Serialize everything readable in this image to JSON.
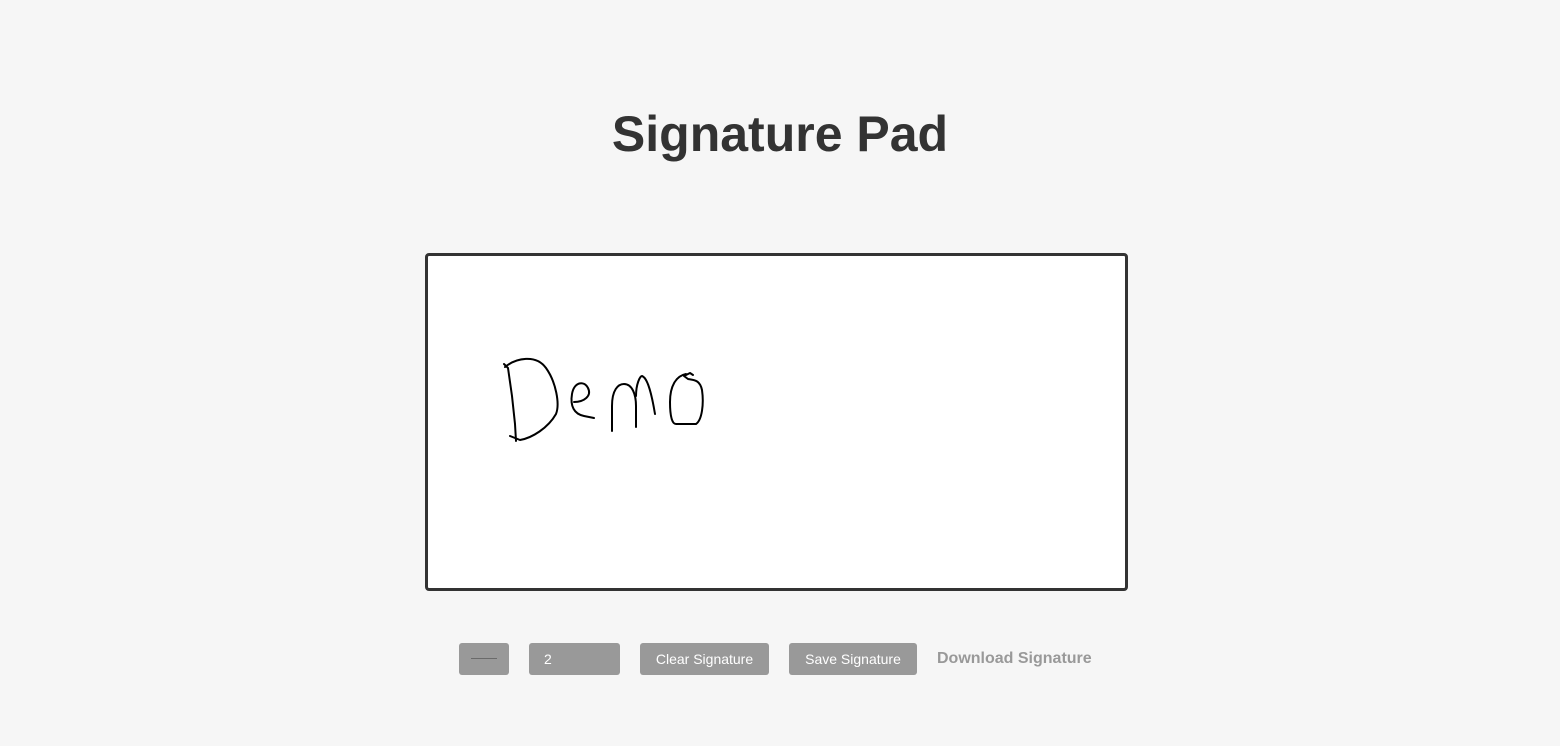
{
  "page": {
    "title": "Signature Pad"
  },
  "pad": {
    "stroke_color": "#000000",
    "background": "#ffffff"
  },
  "controls": {
    "pen_color": "#6a6a6a",
    "pen_width_value": "2",
    "clear_label": "Clear Signature",
    "save_label": "Save Signature",
    "download_label": "Download Signature"
  },
  "colors": {
    "page_background": "#f6f6f6",
    "title_text": "#333333",
    "control_background": "#999999",
    "control_text": "#ffffff",
    "pad_border": "#333333"
  }
}
